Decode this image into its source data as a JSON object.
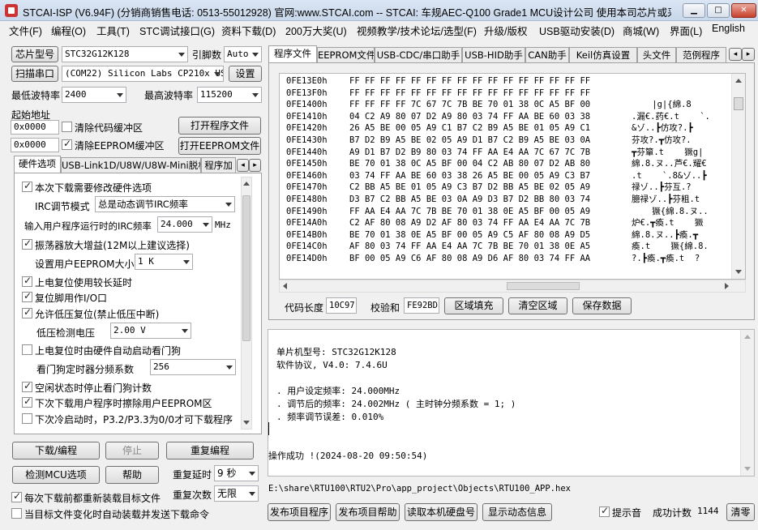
{
  "window": {
    "title": "STCAI-ISP (V6.94F) (分销商销售电话: 0513-55012928) 官网:www.STCAI.com  -- STCAI: 车规AEC-Q100 Grade1 MCU设计公司 使用本司芯片或采…",
    "min": "▁",
    "max": "□",
    "close": "✕"
  },
  "menu": [
    "文件(F)",
    "编程(O)",
    "工具(T)",
    "STC调试接口(G)",
    "资料下载(D)",
    "200万大奖(U)",
    "视频教学/技术论坛/选型(F)",
    "升级/版权",
    "USB驱动安装(D)",
    "商城(W)",
    "界面(L)",
    "English"
  ],
  "left": {
    "chip_model_btn": "芯片型号",
    "chip_model": "STC32G12K128",
    "pins_label": "引脚数",
    "pins": "Auto",
    "scan_port_btn": "扫描串口",
    "port": "(COM22) Silicon Labs CP210x US",
    "settings_btn": "设置",
    "min_baud_label": "最低波特率",
    "min_baud": "2400",
    "max_baud_label": "最高波特率",
    "max_baud": "115200",
    "start_addr_label": "起始地址",
    "addr1": "0x0000",
    "clear_code_label": "清除代码缓冲区",
    "open_prog_btn": "打开程序文件",
    "addr2": "0x0000",
    "clear_eeprom_label": "清除EEPROM缓冲区",
    "open_eeprom_btn": "打开EEPROM文件",
    "tabs": [
      "硬件选项",
      "USB-Link1D/U8W/U8W-Mini脱机",
      "程序加"
    ],
    "options": {
      "o1": "本次下载需要修改硬件选项",
      "irc_mode_label": "IRC调节模式",
      "irc_mode": "总是动态调节IRC频率",
      "freq_label": "输入用户程序运行时的IRC频率",
      "freq": "24.000",
      "freq_unit": "MHz",
      "o2": "振荡器放大增益(12M以上建议选择)",
      "eeprom_label": "设置用户EEPROM大小",
      "eeprom": "1  K",
      "o3": "上电复位使用较长延时",
      "o4": "复位脚用作I/O口",
      "o5": "允许低压复位(禁止低压中断)",
      "lv_label": "低压检测电压",
      "lv": "2.00 V",
      "o6": "上电复位时由硬件自动启动看门狗",
      "wdt_label": "看门狗定时器分频系数",
      "wdt": "256",
      "o7": "空闲状态时停止看门狗计数",
      "o8": "下次下载用户程序时擦除用户EEPROM区",
      "o9": "下次冷启动时，P3.2/P3.3为0/0才可下载程序"
    },
    "download_btn": "下载/编程",
    "stop_btn": "停止",
    "reprogram_btn": "重复编程",
    "check_mcu_btn": "检测MCU选项",
    "help_btn": "帮助",
    "repeat_delay_label": "重复延时",
    "repeat_delay": "9 秒",
    "repeat_count_label": "重复次数",
    "repeat_count": "无限",
    "reload_label": "每次下载前都重新装载目标文件",
    "auto_send_label": "当目标文件变化时自动装载并发送下载命令"
  },
  "right": {
    "tabs": [
      "程序文件",
      "EEPROM文件",
      "USB-CDC/串口助手",
      "USB-HID助手",
      "CAN助手",
      "Keil仿真设置",
      "头文件",
      "范例程序"
    ],
    "hex": [
      {
        "addr": "0FE13E0h",
        "bytes": "FF FF FF FF FF FF FF FF FF FF FF FF FF FF FF FF",
        "ascii": ""
      },
      {
        "addr": "0FE13F0h",
        "bytes": "FF FF FF FF FF FF FF FF FF FF FF FF FF FF FF FF",
        "ascii": ""
      },
      {
        "addr": "0FE1400h",
        "bytes": "FF FF FF FF 7C 67 7C 7B BE 70 01 38 0C A5 BF 00",
        "ascii": "    |g|{綿.8"
      },
      {
        "addr": "0FE1410h",
        "bytes": "04 C2 A9 80 07 D2 A9 80 03 74 FF AA BE 60 03 38",
        "ascii": ".漏€.药€.t    `."
      },
      {
        "addr": "0FE1420h",
        "bytes": "26 A5 BE 00 05 A9 C1 B7 C2 B9 A5 BE 01 05 A9 C1",
        "ascii": "&ゾ..┣仿攻?.┣"
      },
      {
        "addr": "0FE1430h",
        "bytes": "B7 D2 B9 A5 BE 02 05 A9 D1 B7 C2 B9 A5 BE 03 0A",
        "ascii": "芬攻?.┳仿攻?."
      },
      {
        "addr": "0FE1440h",
        "bytes": "A9 D1 B7 D2 B9 80 03 74 FF AA E4 AA 7C 67 7C 7B",
        "ascii": "┳芬簞.t    獗g|"
      },
      {
        "addr": "0FE1450h",
        "bytes": "BE 70 01 38 0C A5 BF 00 04 C2 AB 80 07 D2 AB 80",
        "ascii": "綿.8.ヌ..芦€.耀€"
      },
      {
        "addr": "0FE1460h",
        "bytes": "03 74 FF AA BE 60 03 38 26 A5 BE 00 05 A9 C3 B7",
        "ascii": ".t    `.8&ゾ..┣"
      },
      {
        "addr": "0FE1470h",
        "bytes": "C2 BB A5 BE 01 05 A9 C3 B7 D2 BB A5 BE 02 05 A9",
        "ascii": "禄ゾ..┣芬互.?"
      },
      {
        "addr": "0FE1480h",
        "bytes": "D3 B7 C2 BB A5 BE 03 0A A9 D3 B7 D2 BB 80 03 74",
        "ascii": "臆禄ゾ..┣芬粗.t"
      },
      {
        "addr": "0FE1490h",
        "bytes": "FF AA E4 AA 7C 7B BE 70 01 38 0E A5 BF 00 05 A9",
        "ascii": "    獗{綿.8.ヌ.."
      },
      {
        "addr": "0FE14A0h",
        "bytes": "C2 AF 80 08 A9 D2 AF 80 03 74 FF AA E4 AA 7C 7B",
        "ascii": "炉€.┳瘓.t    獗"
      },
      {
        "addr": "0FE14B0h",
        "bytes": "BE 70 01 38 0E A5 BF 00 05 A9 C5 AF 80 08 A9 D5",
        "ascii": "綿.8.ヌ..┣瘓.┳"
      },
      {
        "addr": "0FE14C0h",
        "bytes": "AF 80 03 74 FF AA E4 AA 7C 7B BE 70 01 38 0E A5",
        "ascii": "瘓.t    獗{綿.8."
      },
      {
        "addr": "0FE14D0h",
        "bytes": "BF 00 05 A9 C6 AF 80 08 A9 D6 AF 80 03 74 FF AA",
        "ascii": "?.┣瘓.┳瘓.t  ?"
      }
    ],
    "code_len_label": "代码长度",
    "code_len": "10C97",
    "checksum_label": "校验和",
    "checksum": "FE92BD",
    "fill_btn": "区域填充",
    "clear_btn": "清空区域",
    "save_btn": "保存数据",
    "log": [
      "单片机型号: STC32G12K128",
      "软件协议, V4.0: 7.4.6U",
      "",
      ". 用户设定频率: 24.000MHz",
      ". 调节后的频率: 24.002MHz ( 主时钟分频系数 = 1; )",
      ". 频率调节误差: 0.010%",
      "",
      "",
      "操作成功 !(2024-08-20 09:50:54)"
    ],
    "file_path": "E:\\share\\RTU100\\RTU2\\Pro\\app_project\\Objects\\RTU100_APP.hex",
    "publish_btn": "发布项目程序",
    "publish_help_btn": "发布项目帮助",
    "read_disk_btn": "读取本机硬盘号",
    "dyn_info_btn": "显示动态信息",
    "beep_label": "提示音",
    "success_label": "成功计数",
    "success_count": "1144",
    "clear_count_btn": "清零"
  }
}
